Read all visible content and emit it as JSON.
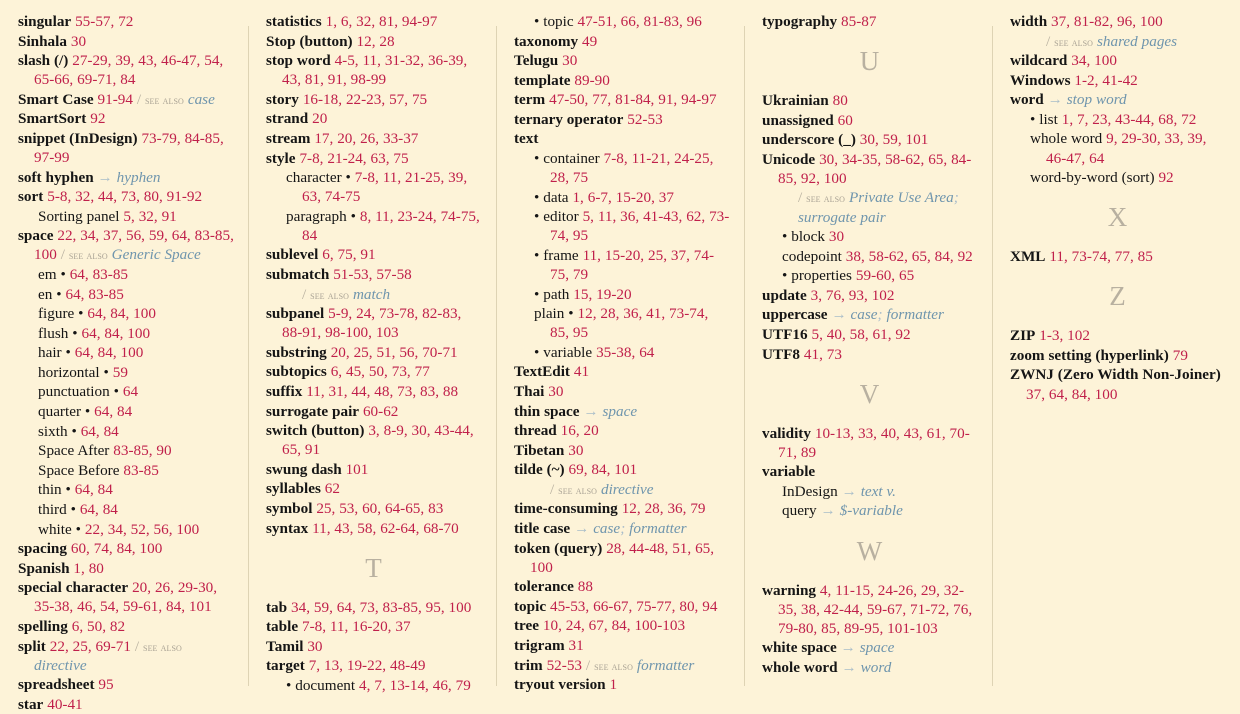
{
  "document": {
    "type": "book-index",
    "page_background": "#fdf3d8",
    "page_number_color": "#c0204b",
    "cross_reference_color": "#6f95ad",
    "section_letter_color": "#b8b0a0",
    "see_also_label": "see also",
    "see_also_slash": "/",
    "arrow_glyph": "→",
    "bullet_glyph": "•",
    "semicolon": ";"
  },
  "columns": [
    {
      "id": "column-1",
      "blocks": [
        {
          "type": "entries",
          "entries": [
            {
              "level": 0,
              "term": "singular",
              "pages": "55-57, 72"
            },
            {
              "level": 0,
              "term": "Sinhala",
              "pages": "30"
            },
            {
              "level": 0,
              "term": "slash (/)",
              "pages": "27-29, 39, 43, 46-47, 54, 65-66, 69-71, 84"
            },
            {
              "level": 0,
              "term": "Smart Case",
              "pages": "91-94",
              "see_also": [
                "case"
              ]
            },
            {
              "level": 0,
              "term": "SmartSort",
              "pages": "92"
            },
            {
              "level": 0,
              "term": "snippet (InDesign)",
              "pages": "73-79, 84-85, 97-99"
            },
            {
              "level": 0,
              "term": "soft hyphen",
              "see": [
                "hyphen"
              ]
            },
            {
              "level": 0,
              "term": "sort",
              "pages": "5-8, 32, 44, 73, 80, 91-92"
            },
            {
              "level": 1,
              "term": "Sorting panel",
              "pages": "5, 32, 91"
            },
            {
              "level": 0,
              "term": "space",
              "pages": "22, 34, 37, 56, 59, 64, 83-85, 100",
              "see_also": [
                "Generic Space"
              ]
            },
            {
              "level": 1,
              "term": "em",
              "bullet": "trailing",
              "pages": "64, 83-85"
            },
            {
              "level": 1,
              "term": "en",
              "bullet": "trailing",
              "pages": "64, 83-85"
            },
            {
              "level": 1,
              "term": "figure",
              "bullet": "trailing",
              "pages": "64, 84, 100"
            },
            {
              "level": 1,
              "term": "flush",
              "bullet": "trailing",
              "pages": "64, 84, 100"
            },
            {
              "level": 1,
              "term": "hair",
              "bullet": "trailing",
              "pages": "64, 84, 100"
            },
            {
              "level": 1,
              "term": "horizontal",
              "bullet": "trailing",
              "pages": "59"
            },
            {
              "level": 1,
              "term": "punctuation",
              "bullet": "trailing",
              "pages": "64"
            },
            {
              "level": 1,
              "term": "quarter",
              "bullet": "trailing",
              "pages": "64, 84"
            },
            {
              "level": 1,
              "term": "sixth",
              "bullet": "trailing",
              "pages": "64, 84"
            },
            {
              "level": 1,
              "term": "Space After",
              "pages": "83-85, 90"
            },
            {
              "level": 1,
              "term": "Space Before",
              "pages": "83-85"
            },
            {
              "level": 1,
              "term": "thin",
              "bullet": "trailing",
              "pages": "64, 84"
            },
            {
              "level": 1,
              "term": "third",
              "bullet": "trailing",
              "pages": "64, 84"
            },
            {
              "level": 1,
              "term": "white",
              "bullet": "trailing",
              "pages": "22, 34, 52, 56, 100"
            },
            {
              "level": 0,
              "term": "spacing",
              "pages": "60, 74, 84, 100"
            },
            {
              "level": 0,
              "term": "Spanish",
              "pages": "1, 80"
            },
            {
              "level": 0,
              "term": "special character",
              "pages": "20, 26, 29-30, 35-38, 46, 54, 59-61, 84, 101"
            },
            {
              "level": 0,
              "term": "spelling",
              "pages": "6, 50, 82"
            },
            {
              "level": 0,
              "term": "split",
              "pages": "22, 25, 69-71",
              "see_also": [
                "directive"
              ]
            },
            {
              "level": 0,
              "term": "spreadsheet",
              "pages": "95"
            },
            {
              "level": 0,
              "term": "star",
              "pages": "40-41"
            }
          ]
        }
      ]
    },
    {
      "id": "column-2",
      "blocks": [
        {
          "type": "entries",
          "entries": [
            {
              "level": 0,
              "term": "statistics",
              "pages": "1, 6, 32, 81, 94-97"
            },
            {
              "level": 0,
              "term": "Stop (button)",
              "pages": "12, 28"
            },
            {
              "level": 0,
              "term": "stop word",
              "pages": "4-5, 11, 31-32, 36-39, 43, 81, 91, 98-99"
            },
            {
              "level": 0,
              "term": "story",
              "pages": "16-18, 22-23, 57, 75"
            },
            {
              "level": 0,
              "term": "strand",
              "pages": "20"
            },
            {
              "level": 0,
              "term": "stream",
              "pages": "17, 20, 26, 33-37"
            },
            {
              "level": 0,
              "term": "style",
              "pages": "7-8, 21-24, 63, 75"
            },
            {
              "level": 1,
              "term": "character",
              "bullet": "trailing",
              "pages": "7-8, 11, 21-25, 39, 63, 74-75"
            },
            {
              "level": 1,
              "term": "paragraph",
              "bullet": "trailing",
              "pages": "8, 11, 23-24, 74-75, 84"
            },
            {
              "level": 0,
              "term": "sublevel",
              "pages": "6, 75, 91"
            },
            {
              "level": 0,
              "term": "submatch",
              "pages": "51-53, 57-58",
              "see_also_own_line": [
                "match"
              ]
            },
            {
              "level": 0,
              "term": "subpanel",
              "pages": "5-9, 24, 73-78, 82-83, 88-91, 98-100, 103"
            },
            {
              "level": 0,
              "term": "substring",
              "pages": "20, 25, 51, 56, 70-71"
            },
            {
              "level": 0,
              "term": "subtopics",
              "pages": "6, 45, 50, 73, 77"
            },
            {
              "level": 0,
              "term": "suffix",
              "pages": "11, 31, 44, 48, 73, 83, 88"
            },
            {
              "level": 0,
              "term": "surrogate pair",
              "pages": "60-62"
            },
            {
              "level": 0,
              "term": "switch (button)",
              "pages": "3, 8-9, 30, 43-44, 65, 91"
            },
            {
              "level": 0,
              "term": "swung dash",
              "pages": "101"
            },
            {
              "level": 0,
              "term": "syllables",
              "pages": "62"
            },
            {
              "level": 0,
              "term": "symbol",
              "pages": "25, 53, 60, 64-65, 83"
            },
            {
              "level": 0,
              "term": "syntax",
              "pages": "11, 43, 58, 62-64, 68-70"
            }
          ]
        },
        {
          "type": "section-letter",
          "letter": "T"
        },
        {
          "type": "entries",
          "entries": [
            {
              "level": 0,
              "term": "tab",
              "pages": "34, 59, 64, 73, 83-85, 95, 100"
            },
            {
              "level": 0,
              "term": "table",
              "pages": "7-8, 11, 16-20, 37"
            },
            {
              "level": 0,
              "term": "Tamil",
              "pages": "30"
            },
            {
              "level": 0,
              "term": "target",
              "pages": "7, 13, 19-22, 48-49"
            },
            {
              "level": 1,
              "term": "document",
              "bullet": "leading",
              "pages": "4, 7, 13-14, 46, 79"
            }
          ]
        }
      ]
    },
    {
      "id": "column-3",
      "blocks": [
        {
          "type": "entries",
          "entries": [
            {
              "level": 1,
              "term": "topic",
              "bullet": "leading",
              "pages": "47-51, 66, 81-83, 96"
            },
            {
              "level": 0,
              "term": "taxonomy",
              "pages": "49"
            },
            {
              "level": 0,
              "term": "Telugu",
              "pages": "30"
            },
            {
              "level": 0,
              "term": "template",
              "pages": "89-90"
            },
            {
              "level": 0,
              "term": "term",
              "pages": "47-50, 77, 81-84, 91, 94-97"
            },
            {
              "level": 0,
              "term": "ternary operator",
              "pages": "52-53"
            },
            {
              "level": 0,
              "term": "text"
            },
            {
              "level": 1,
              "term": "container",
              "bullet": "leading",
              "pages": "7-8, 11-21, 24-25, 28, 75"
            },
            {
              "level": 1,
              "term": "data",
              "bullet": "leading",
              "pages": "1, 6-7, 15-20, 37"
            },
            {
              "level": 1,
              "term": "editor",
              "bullet": "leading",
              "pages": "5, 11, 36, 41-43, 62, 73-74, 95"
            },
            {
              "level": 1,
              "term": "frame",
              "bullet": "leading",
              "pages": "11, 15-20, 25, 37, 74-75, 79"
            },
            {
              "level": 1,
              "term": "path",
              "bullet": "leading",
              "pages": "15, 19-20"
            },
            {
              "level": 1,
              "term": "plain",
              "bullet": "trailing",
              "pages": "12, 28, 36, 41, 73-74, 85, 95"
            },
            {
              "level": 1,
              "term": "variable",
              "bullet": "leading",
              "pages": "35-38, 64"
            },
            {
              "level": 0,
              "term": "TextEdit",
              "pages": "41"
            },
            {
              "level": 0,
              "term": "Thai",
              "pages": "30"
            },
            {
              "level": 0,
              "term": "thin space",
              "see": [
                "space"
              ]
            },
            {
              "level": 0,
              "term": "thread",
              "pages": "16, 20"
            },
            {
              "level": 0,
              "term": "Tibetan",
              "pages": "30"
            },
            {
              "level": 0,
              "term": "tilde (~)",
              "pages": "69, 84, 101",
              "see_also_own_line": [
                "directive"
              ]
            },
            {
              "level": 0,
              "term": "time-consuming",
              "pages": "12, 28, 36, 79"
            },
            {
              "level": 0,
              "term": "title case",
              "see": [
                "case",
                "formatter"
              ]
            },
            {
              "level": 0,
              "term": "token (query)",
              "pages": "28, 44-48, 51, 65, 100"
            },
            {
              "level": 0,
              "term": "tolerance",
              "pages": "88"
            },
            {
              "level": 0,
              "term": "topic",
              "pages": "45-53, 66-67, 75-77, 80, 94"
            },
            {
              "level": 0,
              "term": "tree",
              "pages": "10, 24, 67, 84, 100-103"
            },
            {
              "level": 0,
              "term": "trigram",
              "pages": "31"
            },
            {
              "level": 0,
              "term": "trim",
              "pages": "52-53",
              "see_also": [
                "formatter"
              ]
            },
            {
              "level": 0,
              "term": "tryout version",
              "pages": "1"
            }
          ]
        }
      ]
    },
    {
      "id": "column-4",
      "blocks": [
        {
          "type": "entries",
          "entries": [
            {
              "level": 0,
              "term": "typography",
              "pages": "85-87"
            }
          ]
        },
        {
          "type": "section-letter",
          "letter": "U"
        },
        {
          "type": "entries",
          "entries": [
            {
              "level": 0,
              "term": "Ukrainian",
              "pages": "80"
            },
            {
              "level": 0,
              "term": "unassigned",
              "pages": "60"
            },
            {
              "level": 0,
              "term": "underscore (_)",
              "pages": "30, 59, 101"
            },
            {
              "level": 0,
              "term": "Unicode",
              "pages": "30, 34-35, 58-62, 65, 84-85, 92, 100",
              "see_also_own_line": [
                "Private Use Area",
                "surrogate pair"
              ]
            },
            {
              "level": 1,
              "term": "block",
              "bullet": "leading",
              "pages": "30"
            },
            {
              "level": 1,
              "term": "codepoint",
              "pages": "38, 58-62, 65, 84, 92"
            },
            {
              "level": 1,
              "term": "properties",
              "bullet": "leading",
              "pages": "59-60, 65"
            },
            {
              "level": 0,
              "term": "update",
              "pages": "3, 76, 93, 102"
            },
            {
              "level": 0,
              "term": "uppercase",
              "see": [
                "case",
                "formatter"
              ]
            },
            {
              "level": 0,
              "term": "UTF16",
              "pages": "5, 40, 58, 61, 92"
            },
            {
              "level": 0,
              "term": "UTF8",
              "pages": "41, 73"
            }
          ]
        },
        {
          "type": "section-letter",
          "letter": "V"
        },
        {
          "type": "entries",
          "entries": [
            {
              "level": 0,
              "term": "validity",
              "pages": "10-13, 33, 40, 43, 61, 70-71, 89"
            },
            {
              "level": 0,
              "term": "variable"
            },
            {
              "level": 1,
              "term": "InDesign",
              "see": [
                "text v."
              ]
            },
            {
              "level": 1,
              "term": "query",
              "see": [
                "$-variable"
              ]
            }
          ]
        },
        {
          "type": "section-letter",
          "letter": "W"
        },
        {
          "type": "entries",
          "entries": [
            {
              "level": 0,
              "term": "warning",
              "pages": "4, 11-15, 24-26, 29, 32-35, 38, 42-44, 59-67, 71-72, 76, 79-80, 85, 89-95, 101-103"
            },
            {
              "level": 0,
              "term": "white space",
              "see": [
                "space"
              ]
            },
            {
              "level": 0,
              "term": "whole word",
              "see": [
                "word"
              ]
            }
          ]
        }
      ]
    },
    {
      "id": "column-5",
      "blocks": [
        {
          "type": "entries",
          "entries": [
            {
              "level": 0,
              "term": "width",
              "pages": "37, 81-82, 96, 100",
              "see_also_own_line": [
                "shared pages"
              ]
            },
            {
              "level": 0,
              "term": "wildcard",
              "pages": "34, 100"
            },
            {
              "level": 0,
              "term": "Windows",
              "pages": "1-2, 41-42"
            },
            {
              "level": 0,
              "term": "word",
              "see": [
                "stop word"
              ]
            },
            {
              "level": 1,
              "term": "list",
              "bullet": "leading",
              "pages": "1, 7, 23, 43-44, 68, 72"
            },
            {
              "level": 1,
              "term": "whole word",
              "pages": "9, 29-30, 33, 39, 46-47, 64"
            },
            {
              "level": 1,
              "term": "word-by-word (sort)",
              "pages": "92"
            }
          ]
        },
        {
          "type": "section-letter",
          "letter": "X"
        },
        {
          "type": "entries",
          "entries": [
            {
              "level": 0,
              "term": "XML",
              "pages": "11, 73-74, 77, 85"
            }
          ]
        },
        {
          "type": "section-letter",
          "letter": "Z"
        },
        {
          "type": "entries",
          "entries": [
            {
              "level": 0,
              "term": "ZIP",
              "pages": "1-3, 102"
            },
            {
              "level": 0,
              "term": "zoom setting (hyperlink)",
              "pages": "79"
            },
            {
              "level": 0,
              "term": "ZWNJ (Zero Width Non-Joiner)",
              "pages": "37, 64, 84, 100"
            }
          ]
        }
      ]
    }
  ]
}
